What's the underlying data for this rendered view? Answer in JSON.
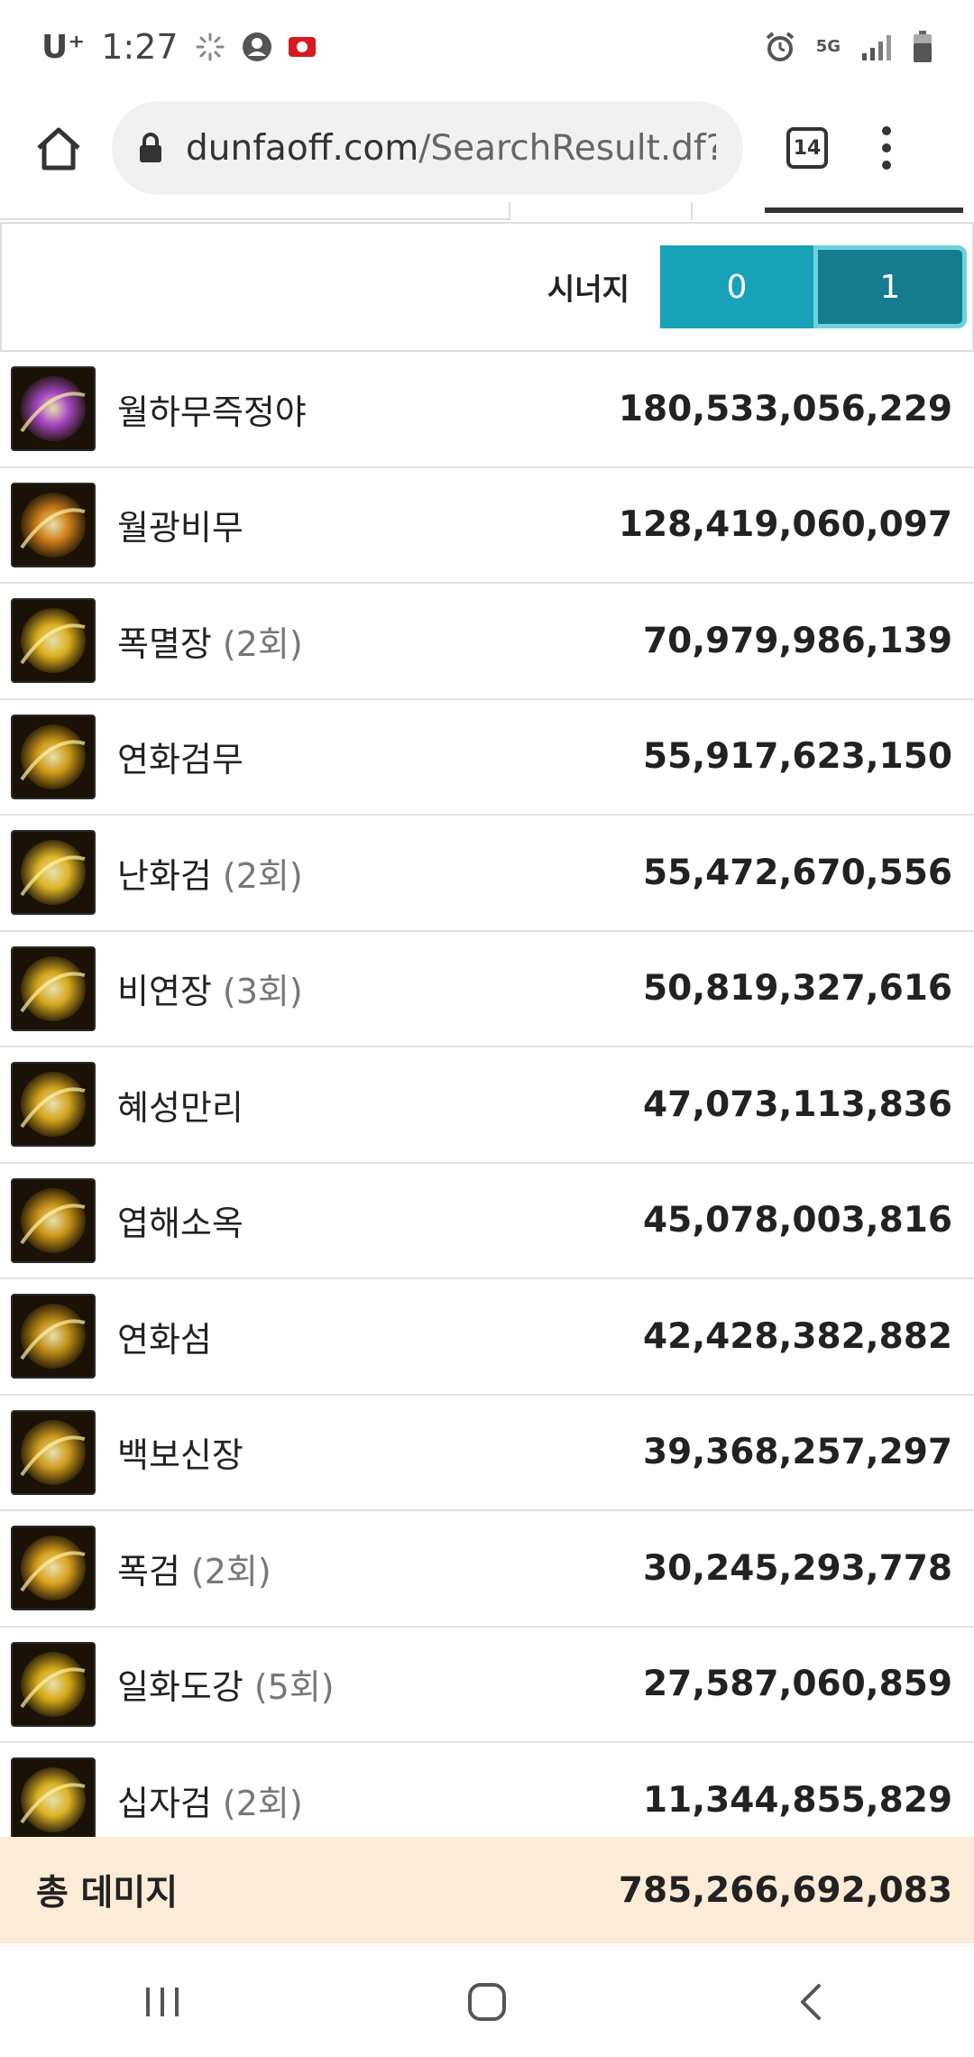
{
  "status_bar": {
    "carrier": "U⁺",
    "time": "1:27",
    "network": "5G",
    "icons": [
      "loading-icon",
      "account-icon",
      "flag-icon",
      "alarm-icon",
      "5g-icon",
      "signal-icon",
      "battery-icon"
    ]
  },
  "browser": {
    "url_host": "dunfaoff.com",
    "url_path": "/SearchResult.df?",
    "tab_count": "14"
  },
  "synergy": {
    "label": "시너지",
    "options": [
      "0",
      "1"
    ],
    "selected": "1",
    "color": "#17a2b8",
    "active_color": "#137c8f"
  },
  "skills": [
    {
      "name": "월하무즉정야",
      "hits": "",
      "damage": "180,533,056,229",
      "icon": "moon-dancer-icon",
      "tint": "#b44dd6"
    },
    {
      "name": "월광비무",
      "hits": "",
      "damage": "128,419,060,097",
      "icon": "moonlight-dance-icon",
      "tint": "#e08a1c"
    },
    {
      "name": "폭멸장",
      "hits": "(2회)",
      "damage": "70,979,986,139",
      "icon": "explosion-palm-icon",
      "tint": "#f0c020"
    },
    {
      "name": "연화검무",
      "hits": "",
      "damage": "55,917,623,150",
      "icon": "lotus-sword-dance-icon",
      "tint": "#e0a818"
    },
    {
      "name": "난화검",
      "hits": "(2회)",
      "damage": "55,472,670,556",
      "icon": "flower-sword-icon",
      "tint": "#f2c628"
    },
    {
      "name": "비연장",
      "hits": "(3회)",
      "damage": "50,819,327,616",
      "icon": "swallow-palm-icon",
      "tint": "#e8b820"
    },
    {
      "name": "혜성만리",
      "hits": "",
      "damage": "47,073,113,836",
      "icon": "comet-icon",
      "tint": "#e8b420"
    },
    {
      "name": "엽해소옥",
      "hits": "",
      "damage": "45,078,003,816",
      "icon": "leaf-sea-icon",
      "tint": "#dca21a"
    },
    {
      "name": "연화섬",
      "hits": "",
      "damage": "42,428,382,882",
      "icon": "lotus-flash-icon",
      "tint": "#d09a18"
    },
    {
      "name": "백보신장",
      "hits": "",
      "damage": "39,368,257,297",
      "icon": "divine-palm-icon",
      "tint": "#e0a820"
    },
    {
      "name": "폭검",
      "hits": "(2회)",
      "damage": "30,245,293,778",
      "icon": "burst-sword-icon",
      "tint": "#f0b020"
    },
    {
      "name": "일화도강",
      "hits": "(5회)",
      "damage": "27,587,060,859",
      "icon": "flower-river-icon",
      "tint": "#e8b818"
    },
    {
      "name": "십자검",
      "hits": "(2회)",
      "damage": "11,344,855,829",
      "icon": "cross-sword-icon",
      "tint": "#f0c428"
    }
  ],
  "total": {
    "label": "총 데미지",
    "value": "785,266,692,083",
    "background": "#fbebd7"
  },
  "navbar": {
    "buttons": [
      "recent-apps-icon",
      "home-icon",
      "back-icon"
    ]
  }
}
